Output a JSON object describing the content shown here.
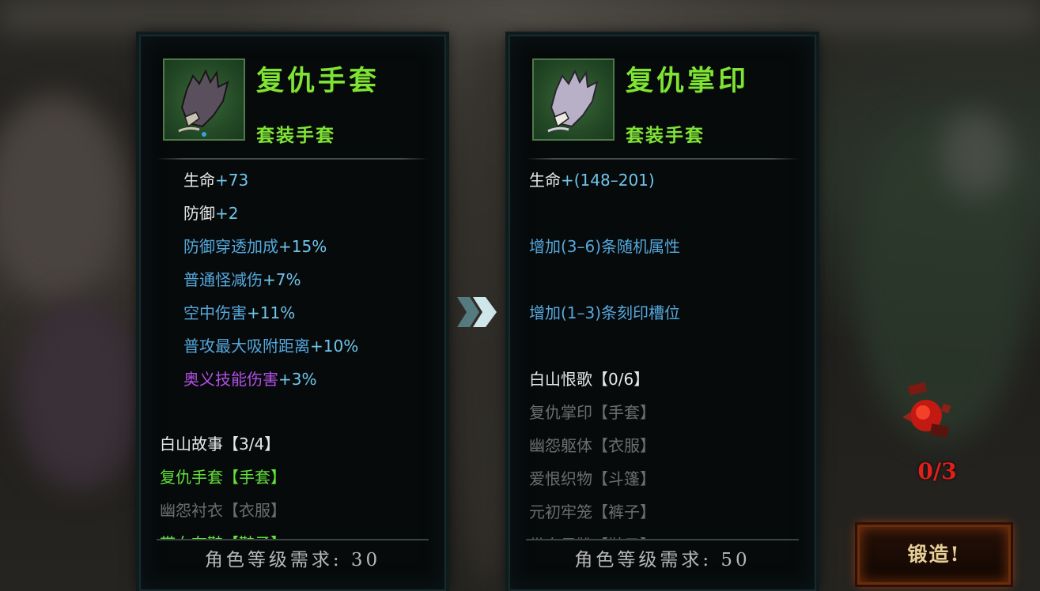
{
  "left_item": {
    "name": "复仇手套",
    "type": "套装手套",
    "stats": [
      {
        "label": "生命",
        "value": "+73"
      },
      {
        "label": "防御",
        "value": "+2"
      },
      {
        "label": "防御穿透加成",
        "value": "+15%"
      },
      {
        "label": "普通怪减伤",
        "value": "+7%"
      },
      {
        "label": "空中伤害",
        "value": "+11%"
      },
      {
        "label": "普攻最大吸附距离",
        "value": "+10%"
      },
      {
        "label": "奥义技能伤害",
        "value": "+3%"
      }
    ],
    "set_title": "白山故事【3/4】",
    "set_items": [
      "复仇手套【手套】",
      "幽怨衬衣【衣服】",
      "带血布鞋【鞋子】"
    ],
    "requirement": "角色等级需求: 30"
  },
  "right_item": {
    "name": "复仇掌印",
    "type": "套装手套",
    "stats": [
      {
        "label": "生命",
        "value": "+(148–201)"
      },
      {
        "label": "增加(3–6)条随机属性",
        "value": ""
      },
      {
        "label": "增加(1–3)条刻印槽位",
        "value": ""
      }
    ],
    "set_title": "白山恨歌【0/6】",
    "set_items": [
      "复仇掌印【手套】",
      "幽怨躯体【衣服】",
      "爱恨织物【斗篷】",
      "元初牢笼【裤子】",
      "带血风靴【鞋子】"
    ],
    "requirement": "角色等级需求: 50"
  },
  "forge": {
    "count": "0/3",
    "button_label": "锻造!"
  }
}
